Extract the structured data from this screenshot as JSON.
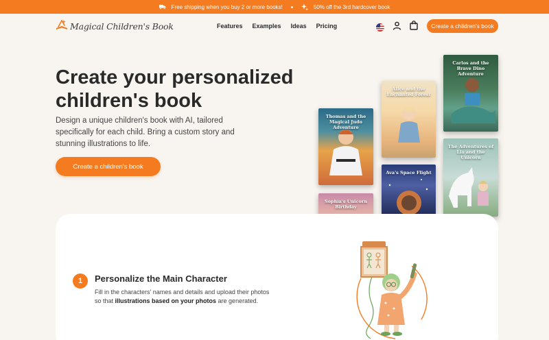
{
  "banner": {
    "shipping_text": "Free shipping when you buy 2 or more books!",
    "discount_text": "50% off the 3rd hardcover book",
    "shipping_icon": "truck-icon",
    "discount_icon": "sparkle-icon"
  },
  "header": {
    "logo_text": "Magical Children's Book",
    "nav": [
      "Features",
      "Examples",
      "Ideas",
      "Pricing"
    ],
    "cta_label": "Create a children's book",
    "icons": [
      "us-flag-icon",
      "user-icon",
      "cart-icon"
    ]
  },
  "hero": {
    "title": "Create your personalized children's book",
    "description": "Design a unique children's book with AI, tailored specifically for each child. Bring a custom story and stunning illustrations to life.",
    "cta_label": "Create a children's book"
  },
  "books": [
    {
      "title": "Thomas and the Magical Judo Adventure"
    },
    {
      "title": "Alice and the Enchanted Forest"
    },
    {
      "title": "Carlos and the Brave Dino Adventure"
    },
    {
      "title": "Ava's Space Flight"
    },
    {
      "title": "The Adventures of Lia and the Unicorn"
    },
    {
      "title": "Sophia's Unicorn Birthday"
    }
  ],
  "step": {
    "number": "1",
    "title": "Personalize the Main Character",
    "desc_before": "Fill in the characters' names and details and upload their photos so that ",
    "desc_bold": "illustrations based on your photos",
    "desc_after": " are generated."
  },
  "colors": {
    "accent": "#f47b20",
    "background": "#f8f4ef",
    "card": "#ffffff"
  }
}
